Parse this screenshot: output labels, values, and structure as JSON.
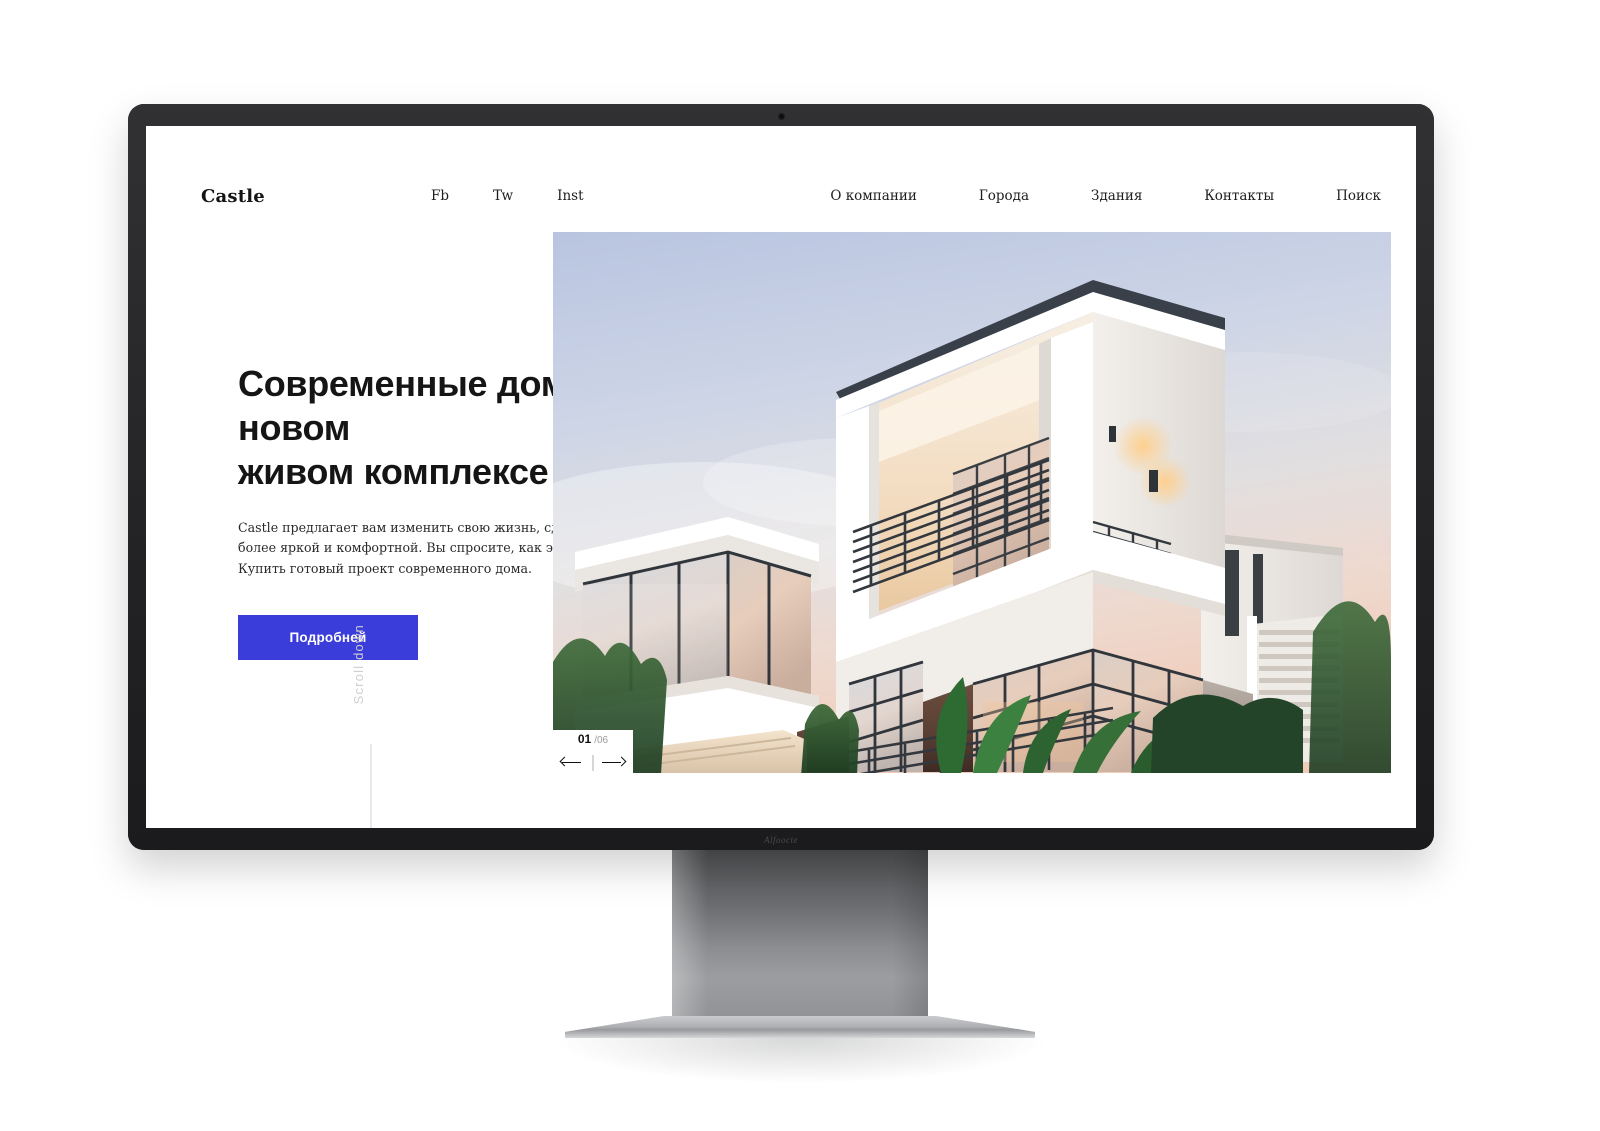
{
  "device": {
    "type": "desktop-monitor-mockup",
    "camera_icon": "camera-dot-icon",
    "brand_mark": "Alfoocte"
  },
  "site": {
    "logo": "Castle",
    "social_links": [
      {
        "label": "Fb",
        "name": "facebook"
      },
      {
        "label": "Tw",
        "name": "twitter"
      },
      {
        "label": "Inst",
        "name": "instagram"
      }
    ],
    "nav_links": [
      {
        "label": "О компании"
      },
      {
        "label": "Города"
      },
      {
        "label": "Здания"
      },
      {
        "label": "Контакты"
      },
      {
        "label": "Поиск"
      }
    ]
  },
  "hero": {
    "title": "Современные дома в новом\nживом комплексе",
    "subtitle": "Castle предлагает вам изменить свою жизнь, сделать ее более яркой и комфортной. Вы спросите, как это сделать? Купить готовый проект современного дома.",
    "cta_label": "Подробней",
    "scroll_label": "Scroll down",
    "image_alt": "Современный двухэтажный белый дом с панорамными окнами на закате"
  },
  "slider": {
    "current": "01",
    "total": "/06",
    "prev_icon": "arrow-left-icon",
    "next_icon": "arrow-right-icon"
  },
  "colors": {
    "accent": "#3b3ddb",
    "text": "#151515",
    "muted": "#cfcfcf",
    "bezel": "#2b2b2d",
    "stand": "#8b8d90"
  }
}
